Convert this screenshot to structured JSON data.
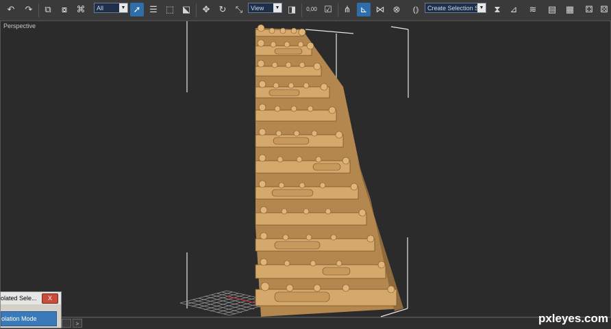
{
  "toolbar": {
    "selection_filter": "All",
    "reference_coord": "View",
    "named_selection": "Create Selection Se",
    "snaps_label": "0,00",
    "icons": [
      "undo-icon",
      "redo-icon",
      "select-link-icon",
      "unlink-icon",
      "bind-spacewarp-icon",
      "select-object-icon",
      "select-by-name-icon",
      "rect-region-icon",
      "window-crossing-icon",
      "move-icon",
      "rotate-icon",
      "scale-icon",
      "pivot-icon",
      "snap-icon",
      "angle-snap-icon",
      "percent-snap-icon",
      "spinner-snap-icon",
      "edit-named-sel-icon",
      "mirror-icon",
      "align-icon",
      "layers-icon",
      "curve-editor-icon",
      "schematic-icon",
      "material-editor-icon",
      "render-setup-icon"
    ]
  },
  "viewport": {
    "label": "Perspective"
  },
  "isolate_panel": {
    "title": "olated Sele...",
    "close": "X",
    "button": "olation Mode"
  },
  "bottom": {
    "next": ">"
  },
  "watermark": "pxleyes.com"
}
